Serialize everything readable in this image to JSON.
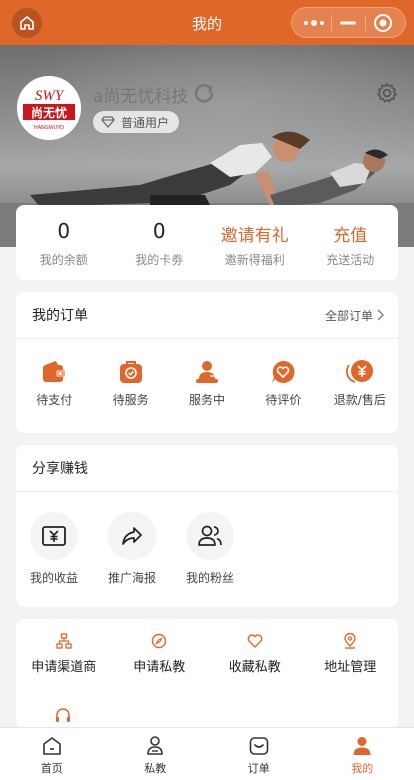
{
  "nav": {
    "title": "我的"
  },
  "profile": {
    "logo_text": "SWY",
    "logo_cn": "尚无忧",
    "logo_sub": "HANGWUYO",
    "username": "a尚无忧科技",
    "level": "普通用户"
  },
  "stats": [
    {
      "value": "0",
      "label": "我的余额"
    },
    {
      "value": "0",
      "label": "我的卡劵"
    },
    {
      "value": "邀请有礼",
      "label": "邀新得福利"
    },
    {
      "value": "充值",
      "label": "充送活动"
    }
  ],
  "orders": {
    "title": "我的订单",
    "more": "全部订单",
    "items": [
      {
        "label": "待支付",
        "icon": "wallet-icon"
      },
      {
        "label": "待服务",
        "icon": "bag-check-icon"
      },
      {
        "label": "服务中",
        "icon": "person-service-icon"
      },
      {
        "label": "待评价",
        "icon": "heart-chat-icon"
      },
      {
        "label": "退款/售后",
        "icon": "refund-icon"
      }
    ]
  },
  "share": {
    "title": "分享赚钱",
    "items": [
      {
        "label": "我的收益",
        "icon": "yen-card-icon"
      },
      {
        "label": "推广海报",
        "icon": "share-arrow-icon"
      },
      {
        "label": "我的粉丝",
        "icon": "users-icon"
      }
    ]
  },
  "services": {
    "items": [
      {
        "label": "申请渠道商",
        "icon": "network-icon"
      },
      {
        "label": "申请私教",
        "icon": "compass-icon"
      },
      {
        "label": "收藏私教",
        "icon": "heart-icon"
      },
      {
        "label": "地址管理",
        "icon": "location-icon"
      }
    ]
  },
  "tabs": [
    {
      "label": "首页",
      "icon": "home-icon"
    },
    {
      "label": "私教",
      "icon": "coach-icon"
    },
    {
      "label": "订单",
      "icon": "order-icon"
    },
    {
      "label": "我的",
      "icon": "user-icon"
    }
  ],
  "colors": {
    "accent": "#e0672a",
    "background": "#f3f3f3"
  }
}
